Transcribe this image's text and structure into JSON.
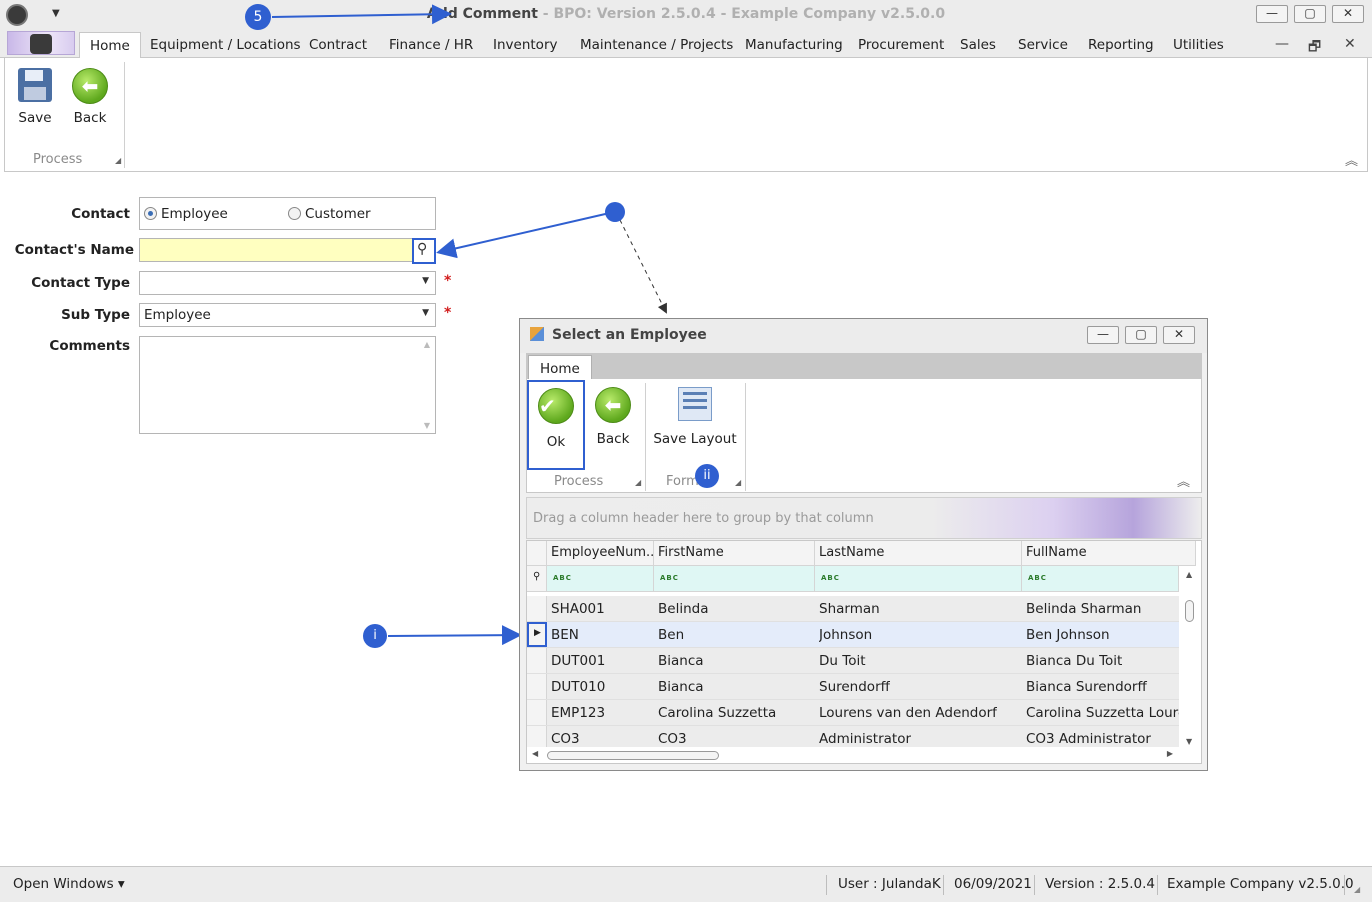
{
  "window": {
    "title_main": "Add Comment",
    "title_rest": "- BPO: Version 2.5.0.4 - Example Company v2.5.0.0",
    "min": "—",
    "max": "▢",
    "close": "✕"
  },
  "tabs": [
    "Home",
    "Equipment / Locations",
    "Contract",
    "Finance / HR",
    "Inventory",
    "Maintenance / Projects",
    "Manufacturing",
    "Procurement",
    "Sales",
    "Service",
    "Reporting",
    "Utilities"
  ],
  "mdi": {
    "min": "—",
    "restore": "🗗",
    "close": "✕"
  },
  "ribbon": {
    "save_label": "Save",
    "back_label": "Back",
    "group_process": "Process"
  },
  "form": {
    "contact_label": "Contact",
    "contact_opt_employee": "Employee",
    "contact_opt_customer": "Customer",
    "name_label": "Contact's Name",
    "type_label": "Contact Type",
    "subtype_label": "Sub Type",
    "subtype_value": "Employee",
    "comments_label": "Comments",
    "required_mark": "*"
  },
  "annotations": {
    "step": "5",
    "i": "i",
    "ii": "ii"
  },
  "dialog": {
    "title": "Select an Employee",
    "tab": "Home",
    "ok_label": "Ok",
    "back_label": "Back",
    "save_layout_label": "Save Layout",
    "group_process": "Process",
    "group_format": "Form",
    "group_hint": "Drag a column header here to group by that column",
    "columns": [
      "EmployeeNum...",
      "FirstName",
      "LastName",
      "FullName"
    ],
    "rows": [
      [
        "SHA001",
        "Belinda",
        "Sharman",
        "Belinda Sharman"
      ],
      [
        "BEN",
        "Ben",
        "Johnson",
        "Ben Johnson"
      ],
      [
        "DUT001",
        "Bianca",
        "Du Toit",
        "Bianca Du Toit"
      ],
      [
        "DUT010",
        "Bianca",
        "Surendorff",
        "Bianca Surendorff"
      ],
      [
        "EMP123",
        "Carolina Suzzetta",
        "Lourens van den Adendorf",
        "Carolina Suzzetta Louren..."
      ],
      [
        "CO3",
        "CO3",
        "Administrator",
        "CO3 Administrator"
      ]
    ]
  },
  "status": {
    "open_windows": "Open Windows ▾",
    "user": "User : JulandaK",
    "date": "06/09/2021",
    "version": "Version : 2.5.0.4",
    "company": "Example Company v2.5.0.0"
  },
  "colors": {
    "accent": "#2f5fd0",
    "input_highlight": "#ffffc0",
    "required": "#d21c1c"
  }
}
